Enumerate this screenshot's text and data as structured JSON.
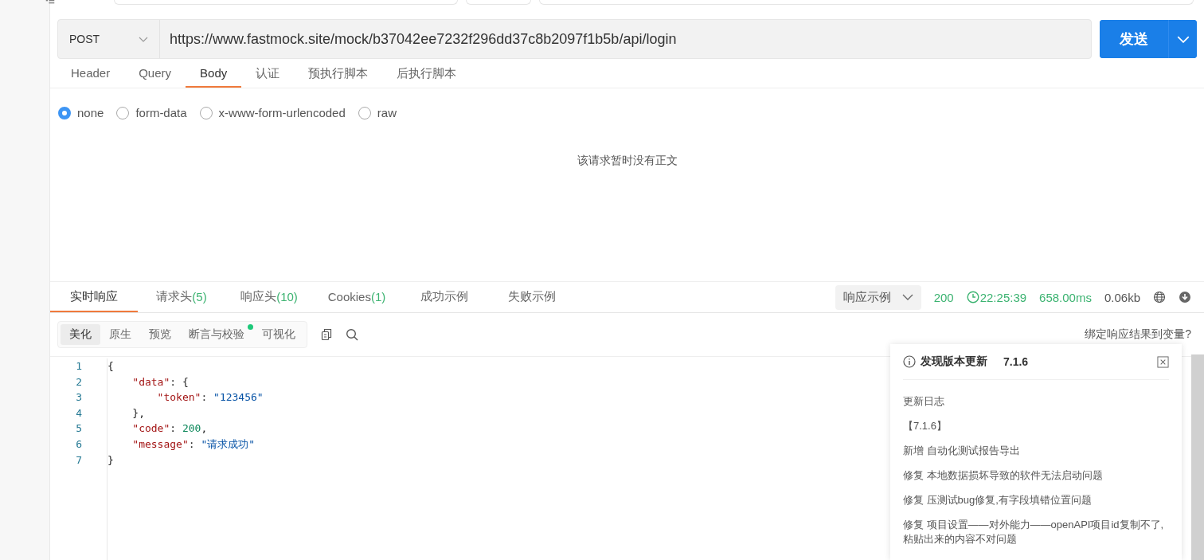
{
  "request": {
    "method": "POST",
    "url": "https://www.fastmock.site/mock/b37042ee7232f296dd37c8b2097f1b5b/api/login",
    "send_button": "发送"
  },
  "request_tabs": [
    {
      "label": "Header",
      "selected": false
    },
    {
      "label": "Query",
      "selected": false
    },
    {
      "label": "Body",
      "selected": true
    },
    {
      "label": "认证",
      "selected": false
    },
    {
      "label": "预执行脚本",
      "selected": false
    },
    {
      "label": "后执行脚本",
      "selected": false
    }
  ],
  "body_types": [
    {
      "label": "none",
      "selected": true
    },
    {
      "label": "form-data",
      "selected": false
    },
    {
      "label": "x-www-form-urlencoded",
      "selected": false
    },
    {
      "label": "raw",
      "selected": false
    }
  ],
  "body_empty_message": "该请求暂时没有正文",
  "response_tabs": [
    {
      "label": "实时响应",
      "selected": true
    },
    {
      "label": "请求头",
      "count": "(5)",
      "selected": false
    },
    {
      "label": "响应头",
      "count": "(10)",
      "selected": false
    },
    {
      "label": "Cookies",
      "count": "(1)",
      "selected": false
    },
    {
      "label": "成功示例",
      "selected": false
    },
    {
      "label": "失败示例",
      "selected": false
    }
  ],
  "response_status": {
    "example_dropdown": "响应示例",
    "status": "200",
    "time": "22:25:39",
    "duration": "658.00ms",
    "size": "0.06kb"
  },
  "view_modes": [
    {
      "label": "美化",
      "selected": true,
      "dot": false
    },
    {
      "label": "原生",
      "selected": false,
      "dot": false
    },
    {
      "label": "预览",
      "selected": false,
      "dot": false
    },
    {
      "label": "断言与校验",
      "selected": false,
      "dot": true
    },
    {
      "label": "可视化",
      "selected": false,
      "dot": false
    }
  ],
  "bind_link": "绑定响应结果到变量?",
  "code_lines": [
    {
      "number": "1",
      "tokens": [
        {
          "kind": "punct",
          "text": "{"
        }
      ]
    },
    {
      "number": "2",
      "tokens": [
        {
          "kind": "key",
          "text": "    \"data\""
        },
        {
          "kind": "punct",
          "text": ": {"
        }
      ]
    },
    {
      "number": "3",
      "tokens": [
        {
          "kind": "key",
          "text": "        \"token\""
        },
        {
          "kind": "punct",
          "text": ": "
        },
        {
          "kind": "string",
          "text": "\"123456\""
        }
      ]
    },
    {
      "number": "4",
      "tokens": [
        {
          "kind": "punct",
          "text": "    },"
        }
      ]
    },
    {
      "number": "5",
      "tokens": [
        {
          "kind": "key",
          "text": "    \"code\""
        },
        {
          "kind": "punct",
          "text": ": "
        },
        {
          "kind": "number",
          "text": "200"
        },
        {
          "kind": "punct",
          "text": ","
        }
      ]
    },
    {
      "number": "6",
      "tokens": [
        {
          "kind": "key",
          "text": "    \"message\""
        },
        {
          "kind": "punct",
          "text": ": "
        },
        {
          "kind": "string",
          "text": "\"请求成功\""
        }
      ]
    },
    {
      "number": "7",
      "tokens": [
        {
          "kind": "punct",
          "text": "}"
        }
      ]
    }
  ],
  "update_popup": {
    "title": "发现版本更新",
    "version": "7.1.6",
    "lines": [
      "更新日志",
      "【7.1.6】",
      "新增 自动化测试报告导出",
      "修复 本地数据损坏导致的软件无法启动问题",
      "修复 压测试bug修复,有字段填错位置问题",
      "修复 项目设置——对外能力——openAPI项目id复制不了,粘贴出来的内容不对问题"
    ]
  }
}
